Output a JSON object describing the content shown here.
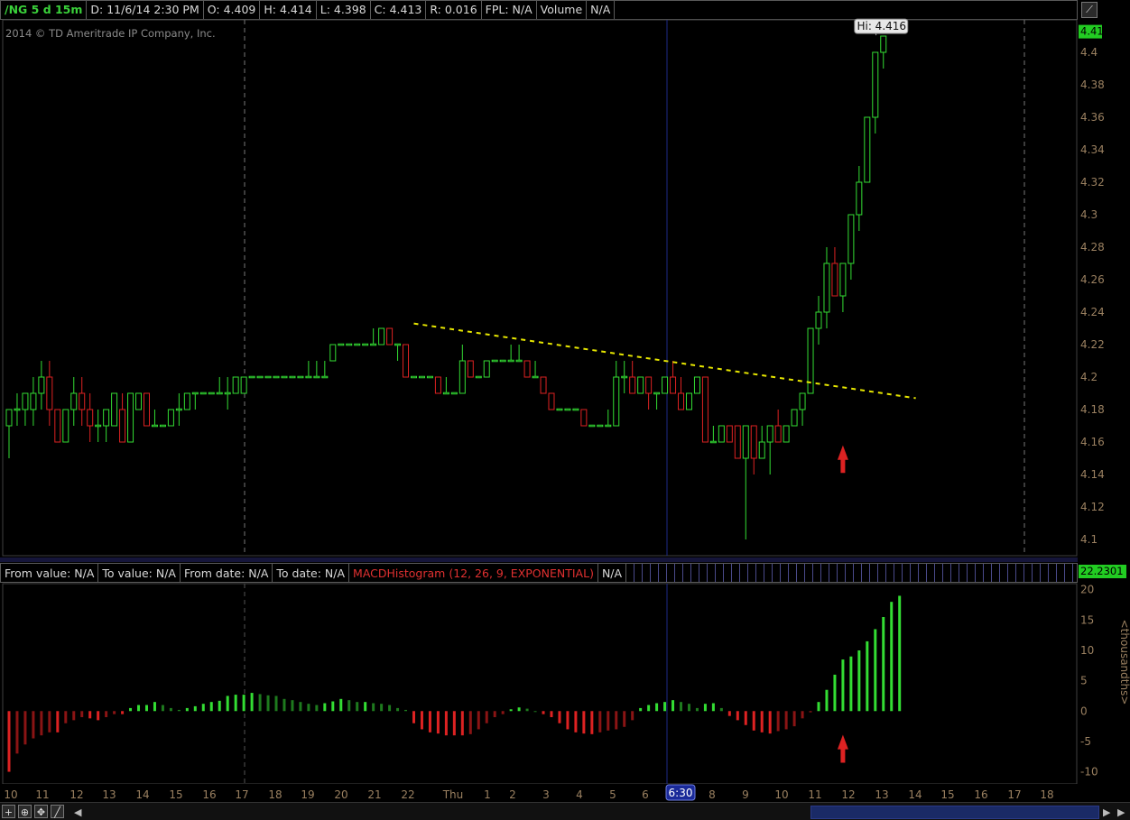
{
  "header": {
    "symbol": "/NG 5 d 15m",
    "date": "D: 11/6/14 2:30 PM",
    "open": "O: 4.409",
    "high": "H: 4.414",
    "low": "L: 4.398",
    "close": "C: 4.413",
    "range": "R: 0.016",
    "fpl": "FPL: N/A",
    "volume_label": "Volume",
    "volume_value": "N/A"
  },
  "copyright": "2014 © TD Ameritrade IP Company, Inc.",
  "lower_header": {
    "from_value": "From value: N/A",
    "to_value": "To value: N/A",
    "from_date": "From date: N/A",
    "to_date": "To date: N/A",
    "study": "MACDHistogram (12, 26, 9, EXPONENTIAL)",
    "study_value": "N/A"
  },
  "colors": {
    "up": "#33dd33",
    "down": "#dd2222",
    "up_dark": "#1e7a1e",
    "down_dark": "#8a1414",
    "trendline": "#e6e600",
    "price_axis": "#9a8060",
    "last_price_bg": "#22cc22"
  },
  "icons": [
    "draw-icon",
    "zoom-in-icon",
    "crosshair-icon",
    "pan-icon",
    "drawing-tool-icon",
    "scroll-left-icon",
    "scroll-right-icon"
  ],
  "chart_data": [
    {
      "type": "candlestick",
      "symbol": "/NG",
      "interval": "15m",
      "ylim": [
        4.09,
        4.42
      ],
      "y_ticks": [
        "4.4",
        "4.38",
        "4.36",
        "4.34",
        "4.32",
        "4.3",
        "4.28",
        "4.26",
        "4.24",
        "4.22",
        "4.2",
        "4.18",
        "4.16",
        "4.14",
        "4.12",
        "4.1"
      ],
      "last_price": "4.413",
      "high_bubble": "Hi: 4.416",
      "x_labels": [
        "10",
        "11",
        "12",
        "13",
        "14",
        "15",
        "16",
        "17",
        "18",
        "19",
        "20",
        "21",
        "22",
        "Thu",
        "1",
        "2",
        "3",
        "4",
        "5",
        "6",
        "6:30",
        "8",
        "9",
        "10",
        "11",
        "12",
        "13",
        "14",
        "15",
        "16",
        "17",
        "18"
      ],
      "highlighted_x_label": "6:30",
      "annotations": [
        "trendline",
        "up-arrow"
      ],
      "candles": [
        [
          4.17,
          4.18,
          4.15,
          4.18
        ],
        [
          4.18,
          4.19,
          4.17,
          4.18
        ],
        [
          4.18,
          4.19,
          4.17,
          4.19
        ],
        [
          4.18,
          4.2,
          4.17,
          4.19
        ],
        [
          4.19,
          4.21,
          4.18,
          4.2
        ],
        [
          4.2,
          4.21,
          4.17,
          4.18
        ],
        [
          4.18,
          4.18,
          4.16,
          4.16
        ],
        [
          4.16,
          4.18,
          4.16,
          4.18
        ],
        [
          4.18,
          4.2,
          4.17,
          4.19
        ],
        [
          4.19,
          4.2,
          4.17,
          4.18
        ],
        [
          4.18,
          4.19,
          4.16,
          4.17
        ],
        [
          4.17,
          4.18,
          4.16,
          4.17
        ],
        [
          4.17,
          4.18,
          4.16,
          4.18
        ],
        [
          4.17,
          4.19,
          4.17,
          4.19
        ],
        [
          4.18,
          4.19,
          4.16,
          4.16
        ],
        [
          4.16,
          4.19,
          4.16,
          4.19
        ],
        [
          4.18,
          4.19,
          4.18,
          4.19
        ],
        [
          4.19,
          4.19,
          4.17,
          4.17
        ],
        [
          4.17,
          4.18,
          4.17,
          4.17
        ],
        [
          4.17,
          4.17,
          4.17,
          4.17
        ],
        [
          4.17,
          4.18,
          4.17,
          4.18
        ],
        [
          4.18,
          4.19,
          4.17,
          4.18
        ],
        [
          4.18,
          4.19,
          4.18,
          4.19
        ],
        [
          4.19,
          4.19,
          4.18,
          4.19
        ],
        [
          4.19,
          4.19,
          4.19,
          4.19
        ],
        [
          4.19,
          4.19,
          4.19,
          4.19
        ],
        [
          4.19,
          4.2,
          4.19,
          4.19
        ],
        [
          4.19,
          4.2,
          4.18,
          4.19
        ],
        [
          4.19,
          4.2,
          4.19,
          4.2
        ],
        [
          4.19,
          4.2,
          4.19,
          4.2
        ],
        [
          4.2,
          4.2,
          4.2,
          4.2
        ],
        [
          4.2,
          4.2,
          4.2,
          4.2
        ],
        [
          4.2,
          4.2,
          4.2,
          4.2
        ],
        [
          4.2,
          4.2,
          4.2,
          4.2
        ],
        [
          4.2,
          4.2,
          4.2,
          4.2
        ],
        [
          4.2,
          4.2,
          4.2,
          4.2
        ],
        [
          4.2,
          4.2,
          4.2,
          4.2
        ],
        [
          4.2,
          4.21,
          4.2,
          4.2
        ],
        [
          4.2,
          4.21,
          4.2,
          4.2
        ],
        [
          4.2,
          4.21,
          4.2,
          4.2
        ],
        [
          4.21,
          4.22,
          4.21,
          4.22
        ],
        [
          4.22,
          4.22,
          4.22,
          4.22
        ],
        [
          4.22,
          4.22,
          4.22,
          4.22
        ],
        [
          4.22,
          4.22,
          4.22,
          4.22
        ],
        [
          4.22,
          4.22,
          4.22,
          4.22
        ],
        [
          4.22,
          4.23,
          4.22,
          4.22
        ],
        [
          4.22,
          4.23,
          4.22,
          4.23
        ],
        [
          4.23,
          4.23,
          4.22,
          4.22
        ],
        [
          4.22,
          4.22,
          4.21,
          4.22
        ],
        [
          4.22,
          4.22,
          4.2,
          4.2
        ],
        [
          4.2,
          4.2,
          4.2,
          4.2
        ],
        [
          4.2,
          4.2,
          4.2,
          4.2
        ],
        [
          4.2,
          4.2,
          4.2,
          4.2
        ],
        [
          4.2,
          4.2,
          4.19,
          4.19
        ],
        [
          4.19,
          4.2,
          4.19,
          4.19
        ],
        [
          4.19,
          4.19,
          4.19,
          4.19
        ],
        [
          4.19,
          4.22,
          4.19,
          4.21
        ],
        [
          4.21,
          4.21,
          4.2,
          4.2
        ],
        [
          4.2,
          4.2,
          4.2,
          4.2
        ],
        [
          4.2,
          4.21,
          4.2,
          4.21
        ],
        [
          4.21,
          4.21,
          4.21,
          4.21
        ],
        [
          4.21,
          4.21,
          4.21,
          4.21
        ],
        [
          4.21,
          4.22,
          4.21,
          4.21
        ],
        [
          4.21,
          4.22,
          4.21,
          4.21
        ],
        [
          4.21,
          4.21,
          4.2,
          4.2
        ],
        [
          4.2,
          4.21,
          4.2,
          4.2
        ],
        [
          4.2,
          4.2,
          4.19,
          4.19
        ],
        [
          4.19,
          4.19,
          4.18,
          4.18
        ],
        [
          4.18,
          4.18,
          4.18,
          4.18
        ],
        [
          4.18,
          4.18,
          4.18,
          4.18
        ],
        [
          4.18,
          4.18,
          4.18,
          4.18
        ],
        [
          4.18,
          4.18,
          4.17,
          4.17
        ],
        [
          4.17,
          4.17,
          4.17,
          4.17
        ],
        [
          4.17,
          4.17,
          4.17,
          4.17
        ],
        [
          4.17,
          4.18,
          4.17,
          4.17
        ],
        [
          4.17,
          4.21,
          4.17,
          4.2
        ],
        [
          4.2,
          4.21,
          4.19,
          4.2
        ],
        [
          4.2,
          4.21,
          4.19,
          4.19
        ],
        [
          4.19,
          4.2,
          4.19,
          4.2
        ],
        [
          4.2,
          4.2,
          4.18,
          4.19
        ],
        [
          4.19,
          4.19,
          4.18,
          4.19
        ],
        [
          4.19,
          4.2,
          4.19,
          4.2
        ],
        [
          4.2,
          4.21,
          4.19,
          4.19
        ],
        [
          4.19,
          4.2,
          4.18,
          4.18
        ],
        [
          4.18,
          4.19,
          4.18,
          4.19
        ],
        [
          4.19,
          4.2,
          4.19,
          4.2
        ],
        [
          4.2,
          4.2,
          4.16,
          4.16
        ],
        [
          4.16,
          4.17,
          4.16,
          4.16
        ],
        [
          4.16,
          4.17,
          4.16,
          4.17
        ],
        [
          4.17,
          4.17,
          4.16,
          4.16
        ],
        [
          4.17,
          4.17,
          4.15,
          4.15
        ],
        [
          4.15,
          4.17,
          4.1,
          4.17
        ],
        [
          4.17,
          4.17,
          4.14,
          4.15
        ],
        [
          4.15,
          4.17,
          4.15,
          4.16
        ],
        [
          4.16,
          4.17,
          4.14,
          4.17
        ],
        [
          4.17,
          4.18,
          4.16,
          4.16
        ],
        [
          4.16,
          4.17,
          4.16,
          4.17
        ],
        [
          4.17,
          4.18,
          4.17,
          4.18
        ],
        [
          4.18,
          4.19,
          4.17,
          4.19
        ],
        [
          4.19,
          4.23,
          4.19,
          4.23
        ],
        [
          4.23,
          4.25,
          4.22,
          4.24
        ],
        [
          4.24,
          4.28,
          4.23,
          4.27
        ],
        [
          4.27,
          4.28,
          4.25,
          4.25
        ],
        [
          4.25,
          4.27,
          4.24,
          4.27
        ],
        [
          4.27,
          4.3,
          4.26,
          4.3
        ],
        [
          4.3,
          4.33,
          4.29,
          4.32
        ],
        [
          4.32,
          4.36,
          4.32,
          4.36
        ],
        [
          4.36,
          4.4,
          4.35,
          4.4
        ],
        [
          4.4,
          4.41,
          4.39,
          4.41
        ]
      ]
    },
    {
      "type": "bar",
      "name": "MACDHistogram (12, 26, 9, EXPONENTIAL)",
      "unit_label": "<thousandths>",
      "last_value": "22.2301",
      "ylim": [
        -12,
        21
      ],
      "y_ticks": [
        "20",
        "15",
        "10",
        "5",
        "0",
        "-5",
        "-10"
      ],
      "values": [
        -10,
        -7,
        -5.5,
        -4.5,
        -4,
        -3.5,
        -3.5,
        -2,
        -1.5,
        -1,
        -1.2,
        -1.5,
        -1,
        -0.5,
        -0.5,
        0.5,
        1,
        1,
        1.5,
        1,
        0.5,
        0.2,
        0.5,
        0.8,
        1.2,
        1.5,
        1.7,
        2.5,
        2.7,
        2.7,
        3,
        2.8,
        2.6,
        2.5,
        2,
        1.8,
        1.5,
        1.2,
        1,
        1.3,
        1.6,
        2,
        1.8,
        1.5,
        1.5,
        1.3,
        1.2,
        1,
        0.5,
        0.2,
        -2,
        -3,
        -3.5,
        -3.7,
        -4,
        -4,
        -4,
        -3.8,
        -3,
        -2,
        -1,
        -0.5,
        0.3,
        0.6,
        0.4,
        0,
        -0.5,
        -1,
        -2,
        -3,
        -3.5,
        -3.7,
        -3.8,
        -3.5,
        -3.2,
        -3,
        -2.6,
        -1.5,
        0.5,
        1,
        1.3,
        1.5,
        1.8,
        1.5,
        1.2,
        0.5,
        1.2,
        1.3,
        0.5,
        -0.8,
        -1.5,
        -2.3,
        -3.2,
        -3.5,
        -3.7,
        -3.3,
        -3,
        -2.5,
        -1.2,
        -0.2,
        1.5,
        3.5,
        6,
        8.5,
        9,
        10,
        11.5,
        13.5,
        15.5,
        18,
        19
      ]
    }
  ]
}
